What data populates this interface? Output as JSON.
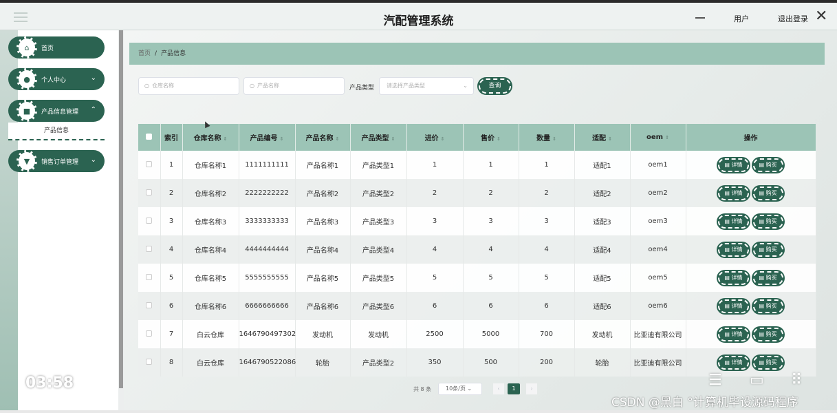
{
  "header": {
    "title": "汽配管理系统",
    "user_label": "用户",
    "logout_label": "退出登录"
  },
  "sidebar": {
    "items": [
      {
        "label": "首页",
        "icon": "home-icon"
      },
      {
        "label": "个人中心",
        "icon": "user-icon"
      },
      {
        "label": "产品信息管理",
        "icon": "product-icon",
        "submenu": "产品信息"
      },
      {
        "label": "销售订单管理",
        "icon": "order-icon"
      }
    ]
  },
  "breadcrumb": {
    "home": "首页",
    "separator": "/",
    "current": "产品信息"
  },
  "search": {
    "warehouse_placeholder": "仓库名称",
    "product_placeholder": "产品名称",
    "type_label": "产品类型",
    "type_placeholder": "请选择产品类型",
    "query_button": "查询"
  },
  "table": {
    "headers": [
      "索引",
      "仓库名称",
      "产品编号",
      "产品名称",
      "产品类型",
      "进价",
      "售价",
      "数量",
      "适配",
      "oem",
      "操作"
    ],
    "detail_label": "详情",
    "buy_label": "购买",
    "rows": [
      {
        "idx": "1",
        "warehouse": "仓库名称1",
        "code": "1111111111",
        "name": "产品名称1",
        "type": "产品类型1",
        "cost": "1",
        "price": "1",
        "qty": "1",
        "fit": "适配1",
        "oem": "oem1"
      },
      {
        "idx": "2",
        "warehouse": "仓库名称2",
        "code": "2222222222",
        "name": "产品名称2",
        "type": "产品类型2",
        "cost": "2",
        "price": "2",
        "qty": "2",
        "fit": "适配2",
        "oem": "oem2"
      },
      {
        "idx": "3",
        "warehouse": "仓库名称3",
        "code": "3333333333",
        "name": "产品名称3",
        "type": "产品类型3",
        "cost": "3",
        "price": "3",
        "qty": "3",
        "fit": "适配3",
        "oem": "oem3"
      },
      {
        "idx": "4",
        "warehouse": "仓库名称4",
        "code": "4444444444",
        "name": "产品名称4",
        "type": "产品类型4",
        "cost": "4",
        "price": "4",
        "qty": "4",
        "fit": "适配4",
        "oem": "oem4"
      },
      {
        "idx": "5",
        "warehouse": "仓库名称5",
        "code": "5555555555",
        "name": "产品名称5",
        "type": "产品类型5",
        "cost": "5",
        "price": "5",
        "qty": "5",
        "fit": "适配5",
        "oem": "oem5"
      },
      {
        "idx": "6",
        "warehouse": "仓库名称6",
        "code": "6666666666",
        "name": "产品名称6",
        "type": "产品类型6",
        "cost": "6",
        "price": "6",
        "qty": "6",
        "fit": "适配6",
        "oem": "oem6"
      },
      {
        "idx": "7",
        "warehouse": "白云仓库",
        "code": "1646790497302",
        "name": "发动机",
        "type": "发动机",
        "cost": "2500",
        "price": "5000",
        "qty": "700",
        "fit": "发动机",
        "oem": "比亚迪有限公司"
      },
      {
        "idx": "8",
        "warehouse": "白云仓库",
        "code": "1646790522086",
        "name": "轮胎",
        "type": "产品类型2",
        "cost": "350",
        "price": "500",
        "qty": "200",
        "fit": "轮胎",
        "oem": "比亚迪有限公司"
      }
    ]
  },
  "pagination": {
    "total": "共 8 条",
    "page_size": "10条/页",
    "current_page": "1",
    "prev": "‹",
    "next": "›"
  },
  "overlay": {
    "time": "03:58",
    "watermark": "CSDN @黑白  °计算机毕设源码程序"
  },
  "colors": {
    "primary": "#2b6351",
    "header_bg": "#9cc4b6"
  }
}
